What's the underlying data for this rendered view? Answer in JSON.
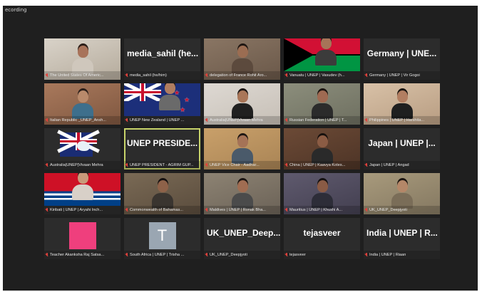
{
  "recording_label": "ecording",
  "tiles": [
    {
      "type": "video",
      "label": "The United States Of Americ...",
      "c1": "#d9d3c9",
      "c2": "#b5ab9c",
      "skin": "#a8735a",
      "hair": "#2a1d18",
      "shirt": "#cfc7bc"
    },
    {
      "type": "name",
      "display": "media_sahil (he...",
      "label": "media_sahil (he/him)"
    },
    {
      "type": "video",
      "label": "delegation of France Rohit Aro...",
      "c1": "#8a7664",
      "c2": "#6a5849",
      "skin": "#9b6d52",
      "hair": "#1e1612",
      "shirt": "#5c4a3d"
    },
    {
      "type": "vanuatu",
      "label": "Vanuatu | UNEP | Vasudev (h..."
    },
    {
      "type": "name",
      "display": "Germany | UNE...",
      "label": "Germany | UNEP | Vir Gogoi"
    },
    {
      "type": "video",
      "label": "Italian Republic _UNEP_Ansh...",
      "c1": "#a9795c",
      "c2": "#7f5740",
      "skin": "#b98a6b",
      "hair": "#2b1f1a",
      "shirt": "#3e6f8c"
    },
    {
      "type": "nz",
      "label": "UNEP New Zealand | UNEP ..."
    },
    {
      "type": "video",
      "label": "Australia|UNEP|Vivaan Mehra",
      "c1": "#ded9d3",
      "c2": "#c6bfb6",
      "skin": "#a97658",
      "hair": "#1a1412",
      "shirt": "#202020"
    },
    {
      "type": "video",
      "label": "Russian Federation | UNEP | T...",
      "c1": "#8c8e7c",
      "c2": "#6e6f60",
      "skin": "#9f6a52",
      "hair": "#1c1410",
      "shirt": "#2b2b2b"
    },
    {
      "type": "video",
      "label": "Philippines | UNEP | Harshita...",
      "c1": "#d8c1a7",
      "c2": "#b89d82",
      "skin": "#b27e61",
      "hair": "#1b1511",
      "shirt": "#1f1f1f"
    },
    {
      "type": "australia",
      "label": "Australia|UNEP|Vivaan Mehra"
    },
    {
      "type": "name",
      "display": "UNEP PRESIDE...",
      "label": "UNEP PRESIDENT - AGRIM GUP...",
      "speaking": true
    },
    {
      "type": "video",
      "label": "UNEP Vice Chair - Aadhar...",
      "c1": "#c9a06a",
      "c2": "#a98455",
      "skin": "#a57357",
      "hair": "#1e1713",
      "shirt": "#4a5a6a"
    },
    {
      "type": "video",
      "label": "China | UNEP | Kaavya Kotes...",
      "c1": "#6c4a36",
      "c2": "#4d3426",
      "skin": "#8b5c44",
      "hair": "#17110e",
      "shirt": "#2a2a2a"
    },
    {
      "type": "name",
      "display": "Japan | UNEP |...",
      "label": "Japan | UNEP | Angad"
    },
    {
      "type": "kiribati",
      "label": "Kiribati | UNEP | Aryahi Inch..."
    },
    {
      "type": "video",
      "label": "Commonwealth of Bahamas...",
      "c1": "#7a6a55",
      "c2": "#5a4c3d",
      "skin": "#8e6249",
      "hair": "#151010",
      "shirt": "#3a3530"
    },
    {
      "type": "video",
      "label": "Maldives | UNEP | Ronak Bha...",
      "c1": "#8d8373",
      "c2": "#6b6257",
      "skin": "#a06d52",
      "hair": "#1a1310",
      "shirt": "#4b4b4b"
    },
    {
      "type": "video",
      "label": "Mauritius | UNEP | Khushi A...",
      "c1": "#5f5a6e",
      "c2": "#433f50",
      "skin": "#8a5b45",
      "hair": "#141010",
      "shirt": "#2d2d38"
    },
    {
      "type": "video",
      "label": "UK_UNEP_Deepjyoti",
      "c1": "#a89a7c",
      "c2": "#847861",
      "skin": "#b48768",
      "hair": "#1c1511",
      "shirt": "#7a6d58"
    },
    {
      "type": "pink",
      "label": "Teacher Akanksha Raj Satsa..."
    },
    {
      "type": "letter",
      "letter": "T",
      "label": "South Africa | UNEP | Trisha ..."
    },
    {
      "type": "name",
      "display": "UK_UNEP_Deep...",
      "label": "UK_UNEP_Deepjyoti"
    },
    {
      "type": "name",
      "display": "tejasveer",
      "label": "tejasveer"
    },
    {
      "type": "name",
      "display": "India | UNEP | R...",
      "label": "India | UNEP | Riaan"
    }
  ]
}
